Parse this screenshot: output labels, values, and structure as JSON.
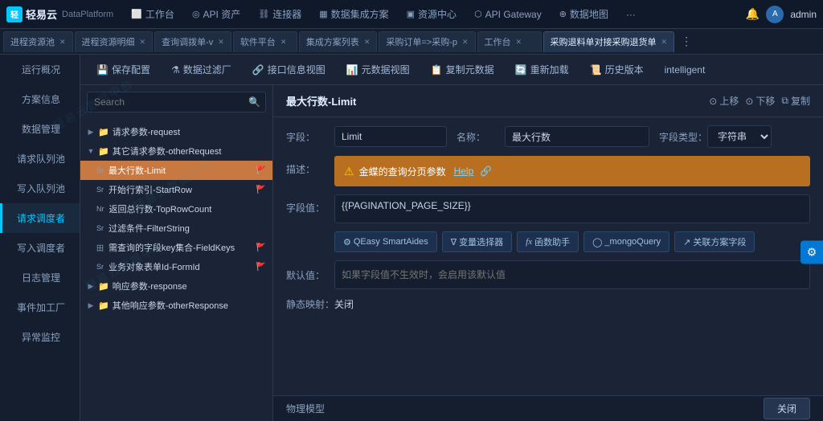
{
  "app": {
    "logo_text": "轻易云",
    "platform": "DataPlatform"
  },
  "top_nav": {
    "items": [
      {
        "label": "工作台",
        "icon": "⬜"
      },
      {
        "label": "API 资产",
        "icon": "◎"
      },
      {
        "label": "连接器",
        "icon": "⛓"
      },
      {
        "label": "数据集成方案",
        "icon": "▦"
      },
      {
        "label": "资源中心",
        "icon": "▣"
      },
      {
        "label": "API Gateway",
        "icon": "⬡"
      },
      {
        "label": "数据地图",
        "icon": "⊕"
      }
    ],
    "more": "···",
    "bell_icon": "🔔",
    "username": "admin"
  },
  "tabs": [
    {
      "label": "进程资源池",
      "closable": true
    },
    {
      "label": "进程资源明细",
      "closable": true
    },
    {
      "label": "查询调拨单-v",
      "closable": true
    },
    {
      "label": "软件平台",
      "closable": true
    },
    {
      "label": "集成方案列表",
      "closable": true
    },
    {
      "label": "采购订单=>采购-p",
      "closable": true
    },
    {
      "label": "工作台",
      "closable": true
    },
    {
      "label": "采购退料单对接采购退货单",
      "closable": true,
      "active": true
    }
  ],
  "sidebar": {
    "items": [
      {
        "label": "运行概况",
        "active": false
      },
      {
        "label": "方案信息",
        "active": false
      },
      {
        "label": "数据管理",
        "active": false
      },
      {
        "label": "请求队列池",
        "active": false
      },
      {
        "label": "写入队列池",
        "active": false
      },
      {
        "label": "请求调度者",
        "active": true
      },
      {
        "label": "写入调度者",
        "active": false
      },
      {
        "label": "日志管理",
        "active": false
      },
      {
        "label": "事件加工厂",
        "active": false
      },
      {
        "label": "异常监控",
        "active": false
      }
    ]
  },
  "toolbar": {
    "buttons": [
      {
        "label": "保存配置",
        "icon": "💾"
      },
      {
        "label": "数据过滤厂",
        "icon": "⚗"
      },
      {
        "label": "接口信息视图",
        "icon": "🔗"
      },
      {
        "label": "元数据视图",
        "icon": "📊"
      },
      {
        "label": "复制元数据",
        "icon": "📋"
      },
      {
        "label": "重新加载",
        "icon": "🔄"
      },
      {
        "label": "历史版本",
        "icon": "📜"
      },
      {
        "label": "intelligent",
        "icon": ""
      }
    ]
  },
  "tree": {
    "search_placeholder": "Search",
    "nodes": [
      {
        "level": 1,
        "type": "folder",
        "label": "请求参数-request",
        "expanded": true,
        "arrow": "▶"
      },
      {
        "level": 1,
        "type": "folder",
        "label": "其它请求参数-otherRequest",
        "expanded": true,
        "arrow": "▼"
      },
      {
        "level": 2,
        "type": "string",
        "badge": "Sr",
        "label": "最大行数-Limit",
        "flag": true,
        "active": true
      },
      {
        "level": 2,
        "type": "string",
        "badge": "Sr",
        "label": "开始行索引-StartRow",
        "flag": true
      },
      {
        "level": 2,
        "type": "number",
        "badge": "Nr",
        "label": "返回总行数-TopRowCount"
      },
      {
        "level": 2,
        "type": "string",
        "badge": "Sr",
        "label": "过滤条件-FilterString"
      },
      {
        "level": 2,
        "type": "grid",
        "badge": "田",
        "label": "需查询的字段key集合-FieldKeys",
        "flag": true
      },
      {
        "level": 2,
        "type": "string",
        "badge": "Sr",
        "label": "业务对象表单Id-FormId",
        "flag": true
      },
      {
        "level": 1,
        "type": "folder",
        "label": "响应参数-response",
        "expanded": false,
        "arrow": "▶"
      },
      {
        "level": 1,
        "type": "folder",
        "label": "其他响应参数-otherResponse",
        "expanded": false,
        "arrow": "▶"
      }
    ]
  },
  "detail": {
    "title": "最大行数-Limit",
    "actions": [
      {
        "label": "上移",
        "icon": "↑"
      },
      {
        "label": "下移",
        "icon": "↓"
      },
      {
        "label": "复制",
        "icon": "⧉"
      }
    ],
    "field_name_label": "字段：",
    "field_name_value": "Limit",
    "name_label": "名称：",
    "name_value": "最大行数",
    "type_label": "字段类型：",
    "type_value": "字符串",
    "desc_label": "描述：",
    "desc_warn": "金蝶的查询分页参数",
    "desc_help": "Help",
    "field_val_label": "字段值：",
    "field_val": "{{PAGINATION_PAGE_SIZE}}",
    "helpers": [
      {
        "label": "QEasy SmartAides",
        "icon": "⚙"
      },
      {
        "label": "变量选择器",
        "icon": "∇"
      },
      {
        "label": "函数助手",
        "icon": "fx"
      },
      {
        "label": "_mongoQuery",
        "icon": "◯"
      },
      {
        "label": "关联方案字段",
        "icon": "↗"
      }
    ],
    "default_label": "默认值：",
    "default_placeholder": "如果字段值不生效时，会启用该默认值",
    "static_label": "静态映射：",
    "static_value": "关闭",
    "physical_label": "物理模型",
    "close_label": "关闭"
  },
  "watermark": "轻易云数据中台"
}
